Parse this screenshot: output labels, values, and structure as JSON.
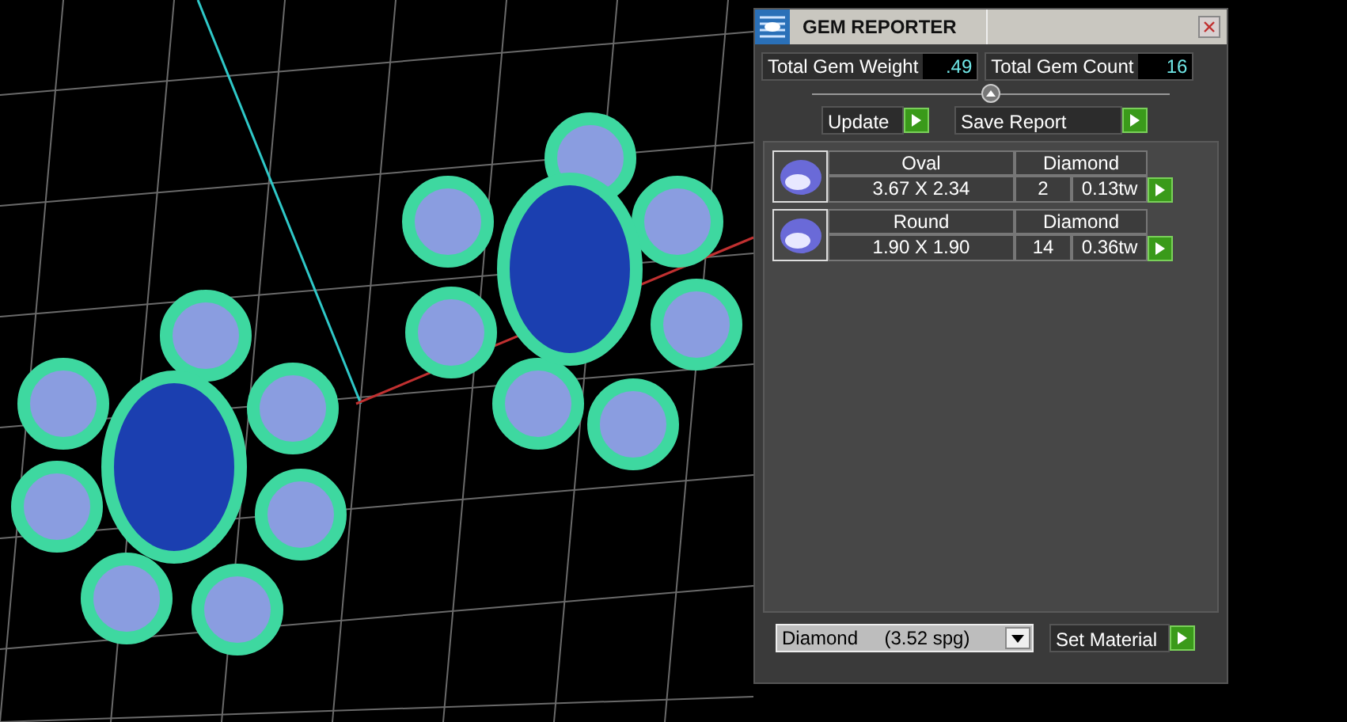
{
  "window": {
    "title": "GEM REPORTER"
  },
  "totals": [
    {
      "label": "Total Gem Weight",
      "value": ".49"
    },
    {
      "label": "Total Gem Count",
      "value": "16"
    }
  ],
  "buttons": [
    {
      "label": "Update"
    },
    {
      "label": "Save Report"
    }
  ],
  "gems": [
    {
      "shape": "Oval",
      "material": "Diamond",
      "size": "3.67 X 2.34",
      "count": "2",
      "weight": "0.13tw"
    },
    {
      "shape": "Round",
      "material": "Diamond",
      "size": "1.90 X 1.90",
      "count": "14",
      "weight": "0.36tw"
    }
  ],
  "material_select": {
    "value": "Diamond     (3.52 spg)"
  },
  "set_material": {
    "label": "Set Material"
  }
}
